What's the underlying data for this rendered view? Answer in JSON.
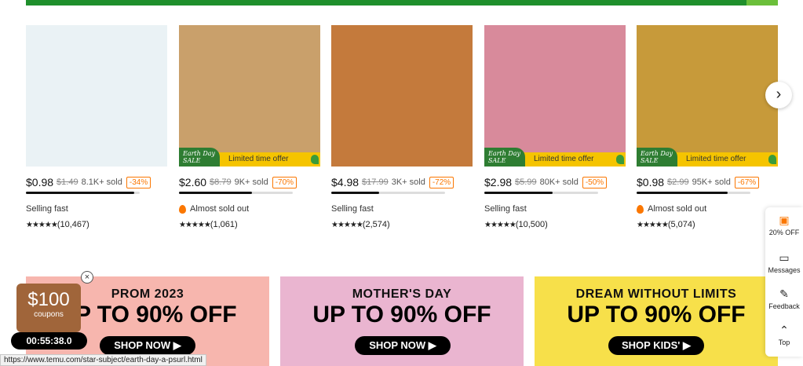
{
  "products": [
    {
      "price": "$0.98",
      "original": "$1.49",
      "sold": "8.1K+ sold",
      "discount": "-34%",
      "status": "Selling fast",
      "flame": false,
      "stars": "★★★★★",
      "reviews": "(10,467)",
      "progress": 0.95,
      "promo": false,
      "img_color": "#eaf2f5"
    },
    {
      "price": "$2.60",
      "original": "$8.79",
      "sold": "9K+ sold",
      "discount": "-70%",
      "status": "Almost sold out",
      "flame": true,
      "stars": "★★★★★",
      "reviews": "(1,061)",
      "progress": 0.64,
      "promo": true,
      "img_color": "#c9a06b"
    },
    {
      "price": "$4.98",
      "original": "$17.99",
      "sold": "3K+ sold",
      "discount": "-72%",
      "status": "Selling fast",
      "flame": false,
      "stars": "★★★★★",
      "reviews": "(2,574)",
      "progress": 0.42,
      "promo": false,
      "img_color": "#c47a3c"
    },
    {
      "price": "$2.98",
      "original": "$5.99",
      "sold": "80K+ sold",
      "discount": "-50%",
      "status": "Selling fast",
      "flame": false,
      "stars": "★★★★★",
      "reviews": "(10,500)",
      "progress": 0.6,
      "promo": true,
      "img_color": "#d88a9b"
    },
    {
      "price": "$0.98",
      "original": "$2.99",
      "sold": "95K+ sold",
      "discount": "-67%",
      "status": "Almost sold out",
      "flame": true,
      "stars": "★★★★★",
      "reviews": "(5,074)",
      "progress": 0.8,
      "promo": true,
      "img_color": "#c79a3a"
    }
  ],
  "promo": {
    "badge_line1": "Earth Day",
    "badge_line2": "SALE",
    "text": "Limited time offer"
  },
  "banners": [
    {
      "sub": "PROM 2023",
      "big": "UP TO 90% OFF",
      "button": "SHOP NOW ▶",
      "bg": "#f7b6ae"
    },
    {
      "sub": "MOTHER'S DAY",
      "big": "UP TO 90% OFF",
      "button": "SHOP NOW ▶",
      "bg": "#eab5d0"
    },
    {
      "sub": "DREAM WITHOUT LIMITS",
      "big": "UP TO 90% OFF",
      "button": "SHOP KIDS' ▶",
      "bg": "#f7e04a"
    }
  ],
  "coupon": {
    "amount": "$100",
    "label": "coupons",
    "timer": "00:55:38.0"
  },
  "sidebar": {
    "discount": "20% OFF",
    "messages": "Messages",
    "feedback": "Feedback",
    "top": "Top"
  },
  "status_url": "https://www.temu.com/star-subject/earth-day-a-psurl.html",
  "icons": {
    "next": "chevron-right-icon",
    "close": "close-icon",
    "flame": "flame-icon",
    "star": "star-icon"
  },
  "colors": {
    "accent": "#fb7701",
    "promo_yellow": "#f5c400",
    "earth_green": "#2e7d32"
  }
}
